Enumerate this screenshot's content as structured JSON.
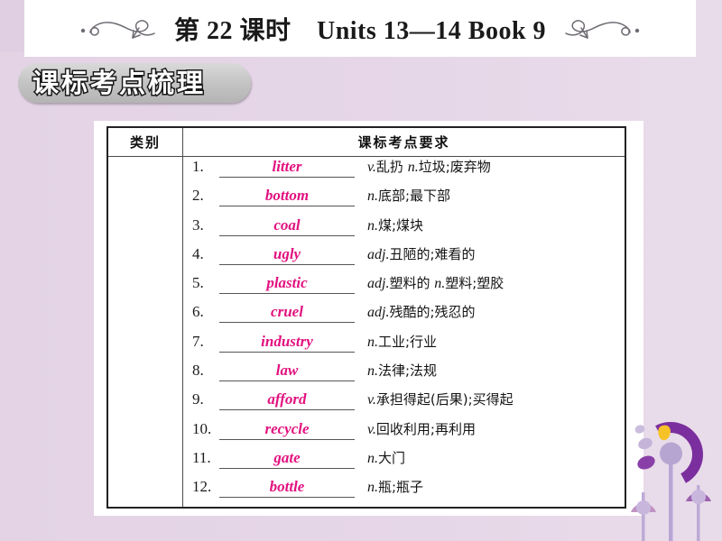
{
  "page": {
    "background_color": "#e6d7e8",
    "accent_answer_color": "#e2117f",
    "banner_gray": "#c4c4c4",
    "deco_purple": "#7b2f9e"
  },
  "header": {
    "title": "第 22 课时　Units 13—14 Book 9",
    "left_flourish_icon": "swirl-flourish-left-icon",
    "right_flourish_icon": "swirl-flourish-right-icon"
  },
  "banner": {
    "label": "课标考点梳理"
  },
  "table": {
    "columns": [
      "类别",
      "课标考点要求"
    ],
    "category_value": "",
    "rows": [
      {
        "num": "1.",
        "answer": "litter",
        "pos1": "v.",
        "meaning1": "乱扔 ",
        "pos2": "n.",
        "meaning2": "垃圾;废弃物"
      },
      {
        "num": "2.",
        "answer": "bottom",
        "pos1": "n.",
        "meaning1": "底部;最下部",
        "pos2": "",
        "meaning2": ""
      },
      {
        "num": "3.",
        "answer": "coal",
        "pos1": "n.",
        "meaning1": "煤;煤块",
        "pos2": "",
        "meaning2": ""
      },
      {
        "num": "4.",
        "answer": "ugly",
        "pos1": "adj.",
        "meaning1": "丑陋的;难看的",
        "pos2": "",
        "meaning2": ""
      },
      {
        "num": "5.",
        "answer": "plastic",
        "pos1": "adj.",
        "meaning1": "塑料的 ",
        "pos2": "n.",
        "meaning2": "塑料;塑胶"
      },
      {
        "num": "6.",
        "answer": "cruel",
        "pos1": "adj.",
        "meaning1": "残酷的;残忍的",
        "pos2": "",
        "meaning2": ""
      },
      {
        "num": "7.",
        "answer": "industry",
        "pos1": "n.",
        "meaning1": "工业;行业",
        "pos2": "",
        "meaning2": ""
      },
      {
        "num": "8.",
        "answer": "law",
        "pos1": "n.",
        "meaning1": "法律;法规",
        "pos2": "",
        "meaning2": ""
      },
      {
        "num": "9.",
        "answer": "afford",
        "pos1": "v.",
        "meaning1": "承担得起(后果);买得起",
        "pos2": "",
        "meaning2": ""
      },
      {
        "num": "10.",
        "answer": "recycle",
        "pos1": "v.",
        "meaning1": "回收利用;再利用",
        "pos2": "",
        "meaning2": ""
      },
      {
        "num": "11.",
        "answer": "gate",
        "pos1": "n.",
        "meaning1": "大门",
        "pos2": "",
        "meaning2": ""
      },
      {
        "num": "12.",
        "answer": "bottle",
        "pos1": "n.",
        "meaning1": "瓶;瓶子",
        "pos2": "",
        "meaning2": ""
      }
    ]
  },
  "decoration": {
    "name": "dandelion-flowers-icon"
  }
}
